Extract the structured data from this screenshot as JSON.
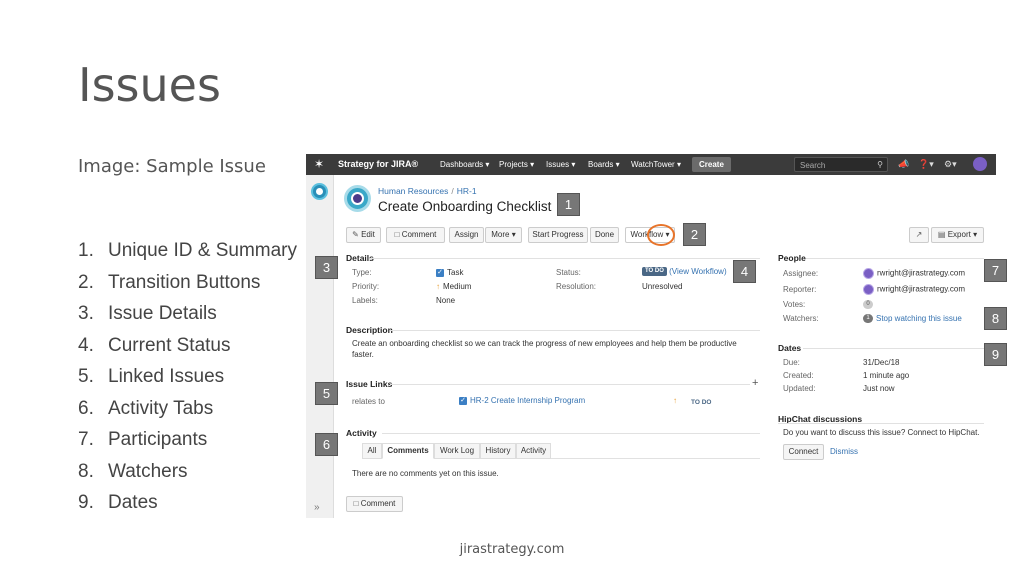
{
  "slide": {
    "title": "Issues",
    "subtitle": "Image: Sample Issue",
    "list": [
      {
        "num": "1.",
        "text": "Unique ID & Summary"
      },
      {
        "num": "2.",
        "text": "Transition Buttons"
      },
      {
        "num": "3.",
        "text": "Issue Details"
      },
      {
        "num": "4.",
        "text": "Current Status"
      },
      {
        "num": "5.",
        "text": "Linked Issues"
      },
      {
        "num": "6.",
        "text": "Activity Tabs"
      },
      {
        "num": "7.",
        "text": "Participants"
      },
      {
        "num": "8.",
        "text": "Watchers"
      },
      {
        "num": "9.",
        "text": "Dates"
      }
    ],
    "footer": "jirastrategy.com"
  },
  "nav": {
    "brand": "Strategy for JIRA®",
    "menus": [
      "Dashboards ▾",
      "Projects ▾",
      "Issues ▾",
      "Boards ▾",
      "WatchTower ▾"
    ],
    "create": "Create",
    "search_placeholder": "Search"
  },
  "issue": {
    "project": "Human Resources",
    "key": "HR-1",
    "title": "Create Onboarding Checklist",
    "buttons": {
      "edit": "Edit",
      "comment": "Comment",
      "assign": "Assign",
      "more": "More ▾",
      "start_progress": "Start Progress",
      "done": "Done",
      "workflow": "Workflow ▾",
      "export": "Export ▾"
    }
  },
  "details": {
    "heading": "Details",
    "type_label": "Type:",
    "type_value": "Task",
    "priority_label": "Priority:",
    "priority_value": "Medium",
    "labels_label": "Labels:",
    "labels_value": "None",
    "status_label": "Status:",
    "status_value": "TO DO",
    "view_workflow": "(View Workflow)",
    "resolution_label": "Resolution:",
    "resolution_value": "Unresolved"
  },
  "description": {
    "heading": "Description",
    "text_line1": "Create an onboarding checklist so we can track the progress of new employees and help them be productive",
    "text_line2": "faster."
  },
  "links": {
    "heading": "Issue Links",
    "relation": "relates to",
    "linked_key": "HR-2",
    "linked_title": "Create Internship Program",
    "linked_status": "TO DO"
  },
  "activity": {
    "heading": "Activity",
    "tabs": [
      "All",
      "Comments",
      "Work Log",
      "History",
      "Activity"
    ],
    "empty": "There are no comments yet on this issue.",
    "comment_button": "Comment"
  },
  "people": {
    "heading": "People",
    "assignee_label": "Assignee:",
    "assignee": "rwright@jirastrategy.com",
    "reporter_label": "Reporter:",
    "reporter": "rwright@jirastrategy.com",
    "votes_label": "Votes:",
    "votes": "0",
    "watchers_label": "Watchers:",
    "watchers_count": "1",
    "stop_watching": "Stop watching this issue"
  },
  "dates": {
    "heading": "Dates",
    "due_label": "Due:",
    "due": "31/Dec/18",
    "created_label": "Created:",
    "created": "1 minute ago",
    "updated_label": "Updated:",
    "updated": "Just now"
  },
  "hipchat": {
    "heading": "HipChat discussions",
    "prompt": "Do you want to discuss this issue? Connect to HipChat.",
    "connect": "Connect",
    "dismiss": "Dismiss"
  },
  "callouts": [
    "1",
    "2",
    "3",
    "4",
    "5",
    "6",
    "7",
    "8",
    "9"
  ],
  "colors": {
    "nav_bg": "#3b3b3b",
    "link": "#3572b0",
    "callout_bg": "#777777",
    "highlight_ring": "#e8742a",
    "status_lozenge": "#4a6785"
  }
}
